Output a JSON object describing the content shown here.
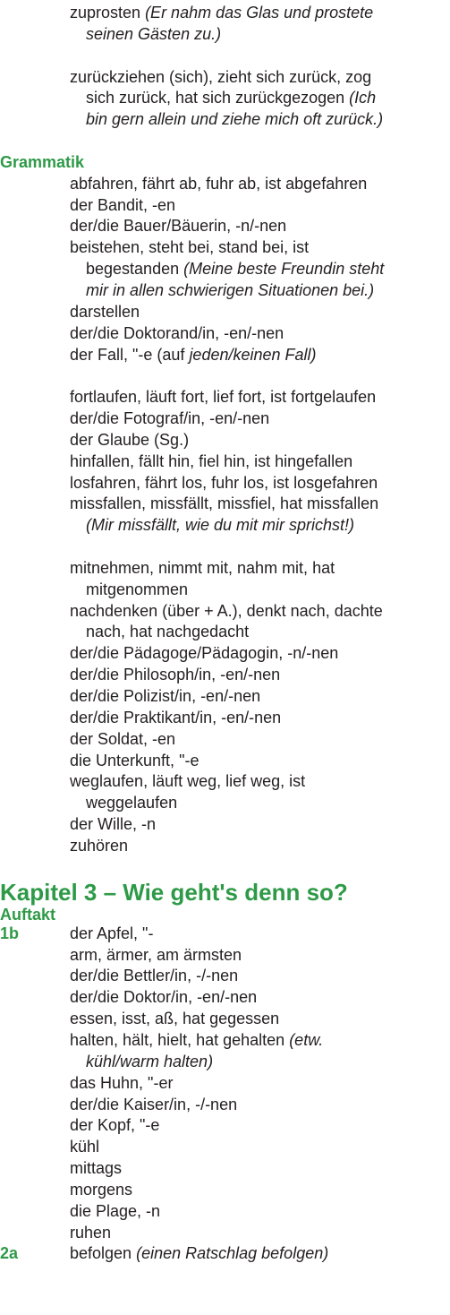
{
  "colors": {
    "accent": "#2e9a47",
    "text": "#231f20"
  },
  "blocks": [
    {
      "type": "entry",
      "lines": [
        [
          {
            "t": "zuprosten "
          },
          {
            "t": "(Er nahm das Glas und prostete",
            "i": true
          }
        ],
        [
          {
            "t": "seinen Gästen zu.)",
            "i": true
          }
        ]
      ]
    },
    {
      "type": "blank"
    },
    {
      "type": "entry",
      "lines": [
        [
          {
            "t": "zurückziehen (sich), zieht sich zurück, zog"
          }
        ],
        [
          {
            "t": "sich zurück, hat sich zurückgezogen "
          },
          {
            "t": "(Ich",
            "i": true
          }
        ],
        [
          {
            "t": "bin gern allein und ziehe mich oft zurück.)",
            "i": true
          }
        ]
      ]
    },
    {
      "type": "blank"
    },
    {
      "type": "section",
      "title": "Grammatik"
    },
    {
      "type": "entry",
      "lines": [
        [
          {
            "t": "abfahren, fährt ab, fuhr ab, ist abgefahren"
          }
        ]
      ]
    },
    {
      "type": "entry",
      "lines": [
        [
          {
            "t": "der Bandit, -en"
          }
        ]
      ]
    },
    {
      "type": "entry",
      "lines": [
        [
          {
            "t": "der/die Bauer/Bäuerin, -n/-nen"
          }
        ]
      ]
    },
    {
      "type": "entry",
      "lines": [
        [
          {
            "t": "beistehen, steht bei, stand bei, ist"
          }
        ],
        [
          {
            "t": "begestanden "
          },
          {
            "t": "(Meine beste Freundin steht",
            "i": true
          }
        ],
        [
          {
            "t": "mir in allen schwierigen Situationen bei.)",
            "i": true
          }
        ]
      ]
    },
    {
      "type": "entry",
      "lines": [
        [
          {
            "t": "darstellen"
          }
        ]
      ]
    },
    {
      "type": "entry",
      "lines": [
        [
          {
            "t": "der/die Doktorand/in, -en/-nen"
          }
        ]
      ]
    },
    {
      "type": "entry",
      "lines": [
        [
          {
            "t": "der Fall, \"-e (auf "
          },
          {
            "t": "jeden/keinen Fall)",
            "i": true
          }
        ]
      ]
    },
    {
      "type": "blank"
    },
    {
      "type": "entry",
      "lines": [
        [
          {
            "t": "fortlaufen, läuft fort, lief fort, ist fortgelaufen"
          }
        ]
      ]
    },
    {
      "type": "entry",
      "lines": [
        [
          {
            "t": "der/die Fotograf/in, -en/-nen"
          }
        ]
      ]
    },
    {
      "type": "entry",
      "lines": [
        [
          {
            "t": "der Glaube (Sg.)"
          }
        ]
      ]
    },
    {
      "type": "entry",
      "lines": [
        [
          {
            "t": "hinfallen, fällt hin, fiel hin, ist hingefallen"
          }
        ]
      ]
    },
    {
      "type": "entry",
      "lines": [
        [
          {
            "t": "losfahren, fährt los, fuhr los, ist losgefahren"
          }
        ]
      ]
    },
    {
      "type": "entry",
      "lines": [
        [
          {
            "t": "missfallen, missfällt, missfiel, hat missfallen"
          }
        ],
        [
          {
            "t": "(Mir missfällt, wie du mit mir sprichst!)",
            "i": true
          }
        ]
      ]
    },
    {
      "type": "blank"
    },
    {
      "type": "entry",
      "lines": [
        [
          {
            "t": "mitnehmen, nimmt mit, nahm mit, hat"
          }
        ],
        [
          {
            "t": "mitgenommen"
          }
        ]
      ]
    },
    {
      "type": "entry",
      "lines": [
        [
          {
            "t": "nachdenken (über + A.), denkt nach, dachte"
          }
        ],
        [
          {
            "t": "nach, hat nachgedacht"
          }
        ]
      ]
    },
    {
      "type": "entry",
      "lines": [
        [
          {
            "t": "der/die Pädagoge/Pädagogin, -n/-nen"
          }
        ]
      ]
    },
    {
      "type": "entry",
      "lines": [
        [
          {
            "t": "der/die Philosoph/in, -en/-nen"
          }
        ]
      ]
    },
    {
      "type": "entry",
      "lines": [
        [
          {
            "t": "der/die Polizist/in, -en/-nen"
          }
        ]
      ]
    },
    {
      "type": "entry",
      "lines": [
        [
          {
            "t": "der/die Praktikant/in, -en/-nen"
          }
        ]
      ]
    },
    {
      "type": "entry",
      "lines": [
        [
          {
            "t": "der Soldat, -en"
          }
        ]
      ]
    },
    {
      "type": "entry",
      "lines": [
        [
          {
            "t": "die Unterkunft, \"-e"
          }
        ]
      ]
    },
    {
      "type": "entry",
      "lines": [
        [
          {
            "t": "weglaufen, läuft weg, lief weg, ist"
          }
        ],
        [
          {
            "t": "weggelaufen"
          }
        ]
      ]
    },
    {
      "type": "entry",
      "lines": [
        [
          {
            "t": "der Wille, -n"
          }
        ]
      ]
    },
    {
      "type": "entry",
      "lines": [
        [
          {
            "t": "zuhören"
          }
        ]
      ]
    },
    {
      "type": "chapter",
      "title": "Kapitel 3 – Wie geht's denn so?"
    },
    {
      "type": "sub",
      "title": "Auftakt"
    },
    {
      "type": "entry",
      "label": "1b",
      "lines": [
        [
          {
            "t": "der Apfel, \"-"
          }
        ]
      ]
    },
    {
      "type": "entry",
      "lines": [
        [
          {
            "t": "arm, ärmer, am ärmsten"
          }
        ]
      ]
    },
    {
      "type": "entry",
      "lines": [
        [
          {
            "t": "der/die Bettler/in, -/-nen"
          }
        ]
      ]
    },
    {
      "type": "entry",
      "lines": [
        [
          {
            "t": "der/die Doktor/in, -en/-nen"
          }
        ]
      ]
    },
    {
      "type": "entry",
      "lines": [
        [
          {
            "t": "essen, isst, aß, hat gegessen"
          }
        ]
      ]
    },
    {
      "type": "entry",
      "lines": [
        [
          {
            "t": "halten, hält, hielt, hat gehalten "
          },
          {
            "t": "(etw.",
            "i": true
          }
        ],
        [
          {
            "t": "kühl/warm halten)",
            "i": true
          }
        ]
      ]
    },
    {
      "type": "entry",
      "lines": [
        [
          {
            "t": "das Huhn, \"-er"
          }
        ]
      ]
    },
    {
      "type": "entry",
      "lines": [
        [
          {
            "t": "der/die Kaiser/in, -/-nen"
          }
        ]
      ]
    },
    {
      "type": "entry",
      "lines": [
        [
          {
            "t": "der Kopf, \"-e"
          }
        ]
      ]
    },
    {
      "type": "entry",
      "lines": [
        [
          {
            "t": "kühl"
          }
        ]
      ]
    },
    {
      "type": "entry",
      "lines": [
        [
          {
            "t": "mittags"
          }
        ]
      ]
    },
    {
      "type": "entry",
      "lines": [
        [
          {
            "t": "morgens"
          }
        ]
      ]
    },
    {
      "type": "entry",
      "lines": [
        [
          {
            "t": "die Plage, -n"
          }
        ]
      ]
    },
    {
      "type": "entry",
      "lines": [
        [
          {
            "t": "ruhen"
          }
        ]
      ]
    },
    {
      "type": "entry",
      "label": "2a",
      "lines": [
        [
          {
            "t": "befolgen "
          },
          {
            "t": "(einen Ratschlag befolgen)",
            "i": true
          }
        ]
      ]
    }
  ]
}
